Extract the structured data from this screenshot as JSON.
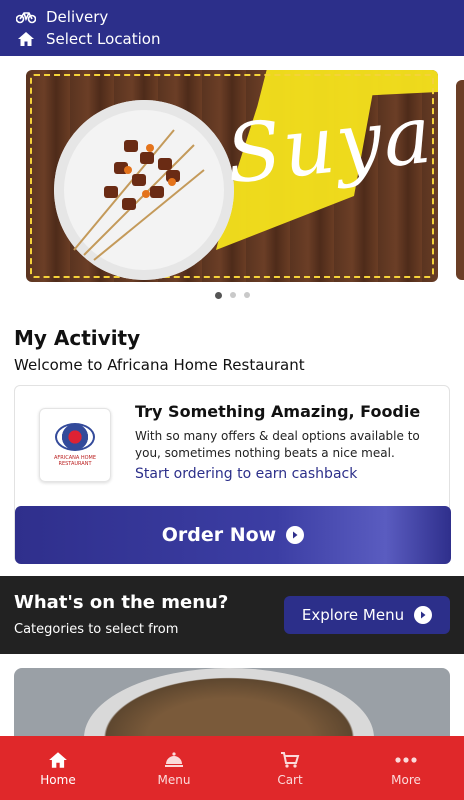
{
  "header": {
    "delivery_label": "Delivery",
    "location_label": "Select Location",
    "delivery_icon": "bicycle-icon",
    "location_icon": "home-icon"
  },
  "carousel": {
    "banner_text": "Suya",
    "active_index": 0,
    "total": 3
  },
  "activity": {
    "title": "My Activity",
    "welcome": "Welcome to Africana Home Restaurant"
  },
  "promo_card": {
    "logo_text": "AFRICANA HOME RESTAURANT",
    "title": "Try Something Amazing, Foodie",
    "description": "With so many offers & deal options available to you, sometimes nothing beats a nice meal.",
    "link": "Start ordering to earn cashback",
    "order_button": "Order Now"
  },
  "menu_section": {
    "heading": "What's on the menu?",
    "subheading": "Categories to select from",
    "explore_button": "Explore Menu"
  },
  "bottom_nav": {
    "items": [
      {
        "label": "Home",
        "icon": "home-icon"
      },
      {
        "label": "Menu",
        "icon": "cloche-icon"
      },
      {
        "label": "Cart",
        "icon": "cart-icon"
      },
      {
        "label": "More",
        "icon": "more-icon"
      }
    ]
  },
  "colors": {
    "primary": "#2c2f8a",
    "nav_bar": "#e0282a",
    "menu_strip": "#222222"
  }
}
